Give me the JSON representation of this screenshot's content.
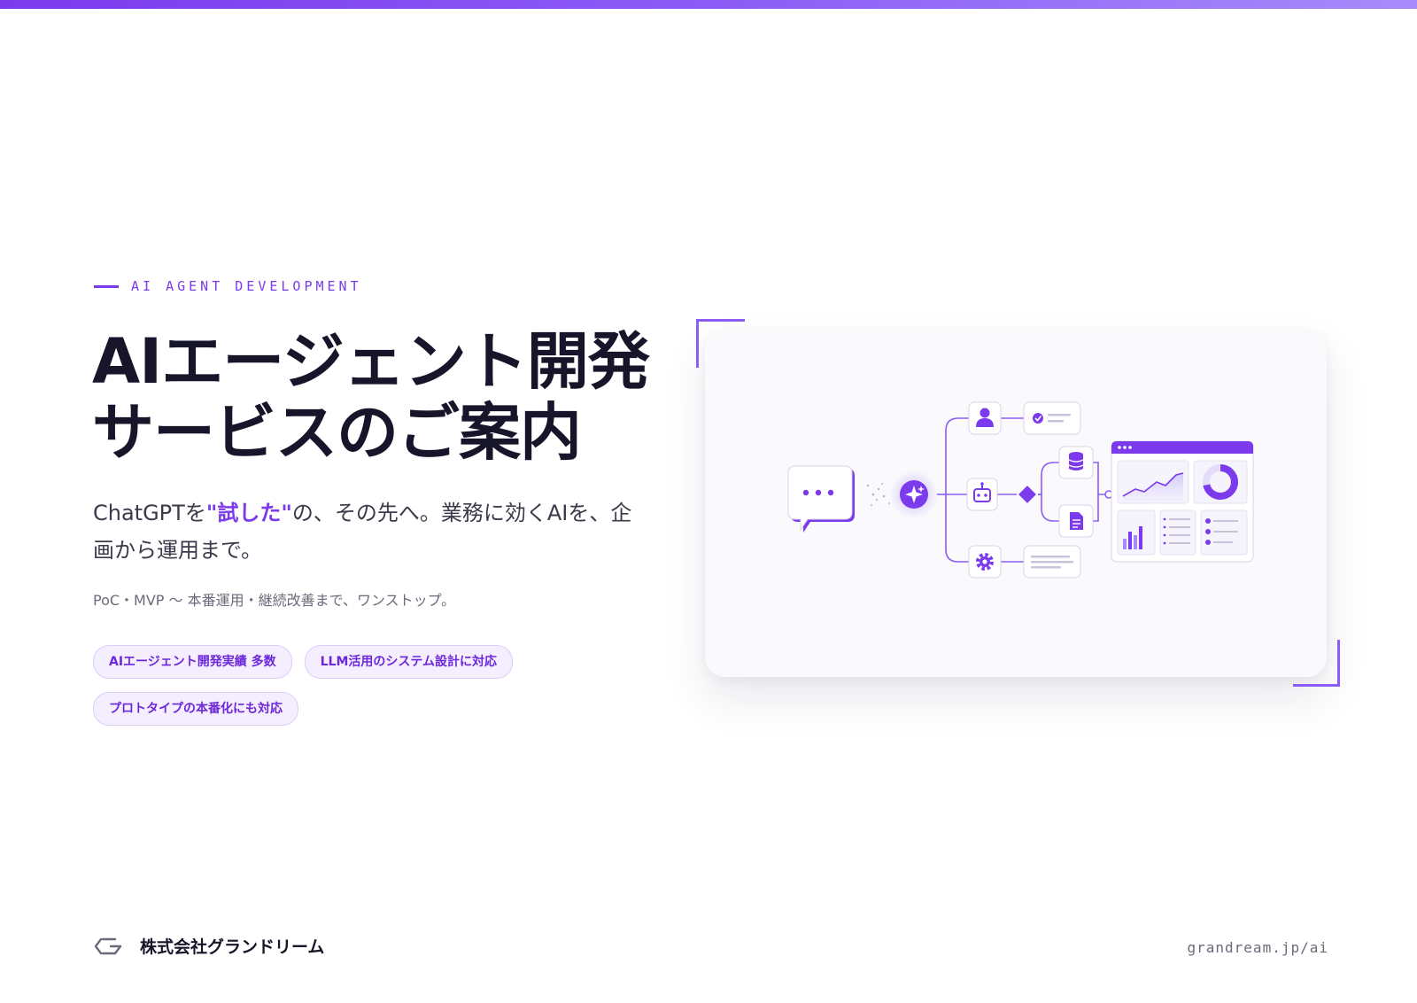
{
  "hero": {
    "eyebrow": "AI AGENT DEVELOPMENT",
    "title_line1": "AIエージェント開発",
    "title_line2": "サービスのご案内",
    "lead_before": "ChatGPTを",
    "lead_highlight": "\"試した\"",
    "lead_after": "の、その先へ。業務に効くAIを、企画から運用まで。",
    "sub": "PoC・MVP 〜 本番運用・継続改善まで、ワンストップ。",
    "tags": [
      "AIエージェント開発実績 多数",
      "LLM活用のシステム設計に対応",
      "プロトタイプの本番化にも対応"
    ]
  },
  "illustration": {
    "icons": [
      "chat-bubble-icon",
      "sparkle-icon",
      "robot-icon",
      "user-icon",
      "check-icon",
      "database-icon",
      "document-icon",
      "gear-icon",
      "dashboard-icon"
    ]
  },
  "footer": {
    "company": "株式会社グランドリーム",
    "url": "grandream.jp/ai"
  },
  "colors": {
    "accent": "#7c3aed",
    "accent_light": "#f4eefe",
    "text": "#16152a"
  }
}
